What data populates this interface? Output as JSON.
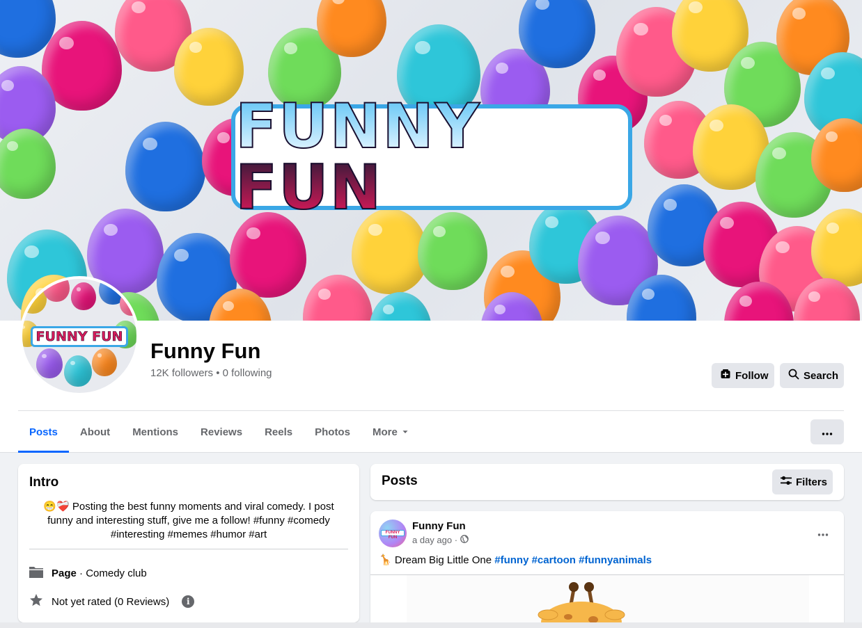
{
  "cover": {
    "logo_text": "FUNNY FUN",
    "balloon_colors": [
      "#ff8a1f",
      "#1f6fe0",
      "#ffd23a",
      "#2ec6d9",
      "#e8147a",
      "#6fdc5a",
      "#9b5cf0",
      "#ff5a8a"
    ]
  },
  "profile": {
    "avatar_logo_text": "FUNNY FUN",
    "name": "Funny Fun",
    "stats": "12K followers • 0 following",
    "follow_label": "Follow",
    "search_label": "Search"
  },
  "nav": {
    "tabs": [
      {
        "label": "Posts"
      },
      {
        "label": "About"
      },
      {
        "label": "Mentions"
      },
      {
        "label": "Reviews"
      },
      {
        "label": "Reels"
      },
      {
        "label": "Photos"
      },
      {
        "label": "More"
      }
    ],
    "active_tab": "Posts"
  },
  "intro": {
    "title": "Intro",
    "bio_emoji": "😁❤️‍🩹",
    "bio": "Posting the best funny moments and viral comedy. I post funny and interesting stuff, give me a follow! #funny #comedy #interesting #memes #humor #art",
    "page_label": "Page",
    "page_category": " · Comedy club",
    "rating": "Not yet rated (0 Reviews)"
  },
  "posts_section": {
    "title": "Posts",
    "filters_label": "Filters"
  },
  "post": {
    "avatar_text": "FUNNY FUN",
    "author": "Funny Fun",
    "time": "a day ago ·",
    "text_emoji": "🦒",
    "text": " Dream Big Little One ",
    "hashtags": [
      "#funny",
      "#cartoon",
      "#funnyanimals"
    ]
  },
  "colors": {
    "accent": "#0866ff",
    "link": "#0064d1",
    "button_bg": "#e4e6eb",
    "page_bg": "#f0f2f5"
  }
}
